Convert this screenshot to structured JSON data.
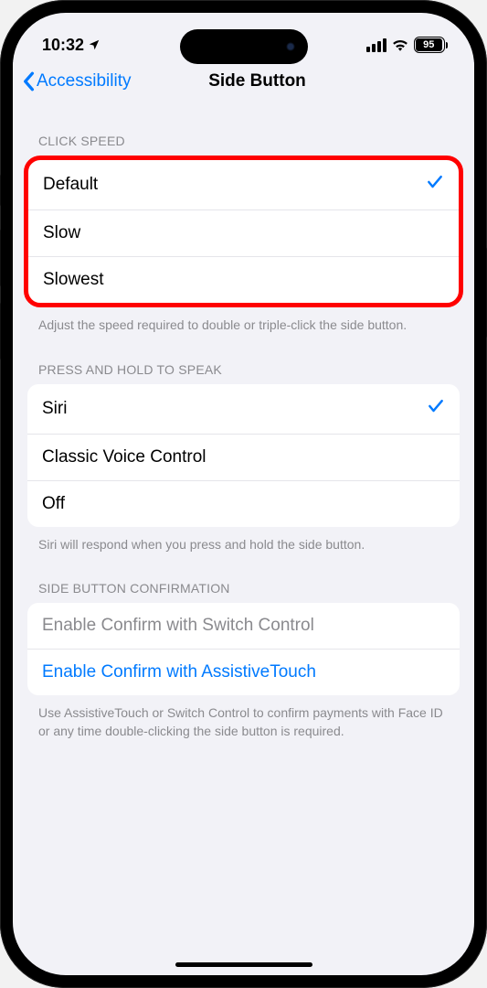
{
  "status": {
    "time": "10:32",
    "battery": "95",
    "battery_pct": 95
  },
  "nav": {
    "back_label": "Accessibility",
    "title": "Side Button"
  },
  "click_speed": {
    "header": "CLICK SPEED",
    "options": [
      "Default",
      "Slow",
      "Slowest"
    ],
    "selected_index": 0,
    "footer": "Adjust the speed required to double or triple-click the side button."
  },
  "press_hold": {
    "header": "PRESS AND HOLD TO SPEAK",
    "options": [
      "Siri",
      "Classic Voice Control",
      "Off"
    ],
    "selected_index": 0,
    "footer": "Siri will respond when you press and hold the side button."
  },
  "confirmation": {
    "header": "SIDE BUTTON CONFIRMATION",
    "switch_control_label": "Enable Confirm with Switch Control",
    "assistive_touch_label": "Enable Confirm with AssistiveTouch",
    "footer": "Use AssistiveTouch or Switch Control to confirm payments with Face ID or any time double-clicking the side button is required."
  }
}
